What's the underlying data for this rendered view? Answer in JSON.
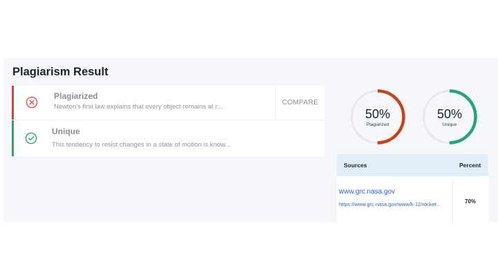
{
  "page_title": "Plagiarism Result",
  "colors": {
    "plagiarized": "#c84418",
    "unique": "#22a578",
    "ring_track": "#e8e8ea",
    "link": "#2a63c9",
    "table_header_bg": "#e3eefb"
  },
  "results": [
    {
      "status": "plagiarized",
      "icon": "x-circle-icon",
      "title": "Plagiarized",
      "snippet": "Newton's first law explains that every object remains at r...",
      "action_label": "COMPARE"
    },
    {
      "status": "unique",
      "icon": "check-circle-icon",
      "title": "Unique",
      "snippet": "This tendency to resist changes in a state of motion is know..."
    }
  ],
  "summary": {
    "plagiarized": {
      "value": "50%",
      "fraction": 0.5,
      "label": "Plagiarized"
    },
    "unique": {
      "value": "50%",
      "fraction": 0.5,
      "label": "Unique"
    }
  },
  "sources_table": {
    "headers": {
      "sources": "Sources",
      "percent": "Percent"
    },
    "rows": [
      {
        "domain": "www.grc.nasa.gov",
        "url": "https://www.grc.nasa.gov/www/k-12/rocket...",
        "percent": "70%"
      }
    ]
  }
}
